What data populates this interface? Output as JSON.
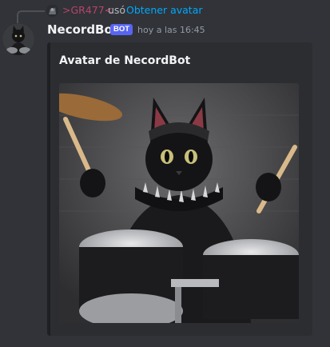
{
  "reply": {
    "user": ">GR477<",
    "action": "usó",
    "command": "Obtener avatar"
  },
  "message": {
    "author": "NecordBot",
    "badge": "BOT",
    "timestamp": "hoy a las 16:45"
  },
  "embed": {
    "title": "Avatar de NecordBot",
    "image_icon": "cat-drummer-image"
  },
  "colors": {
    "background": "#313338",
    "embed_background": "#2b2d31",
    "bot_badge": "#5865f2",
    "reply_user": "#b5446a",
    "command_link": "#00a8fc"
  }
}
